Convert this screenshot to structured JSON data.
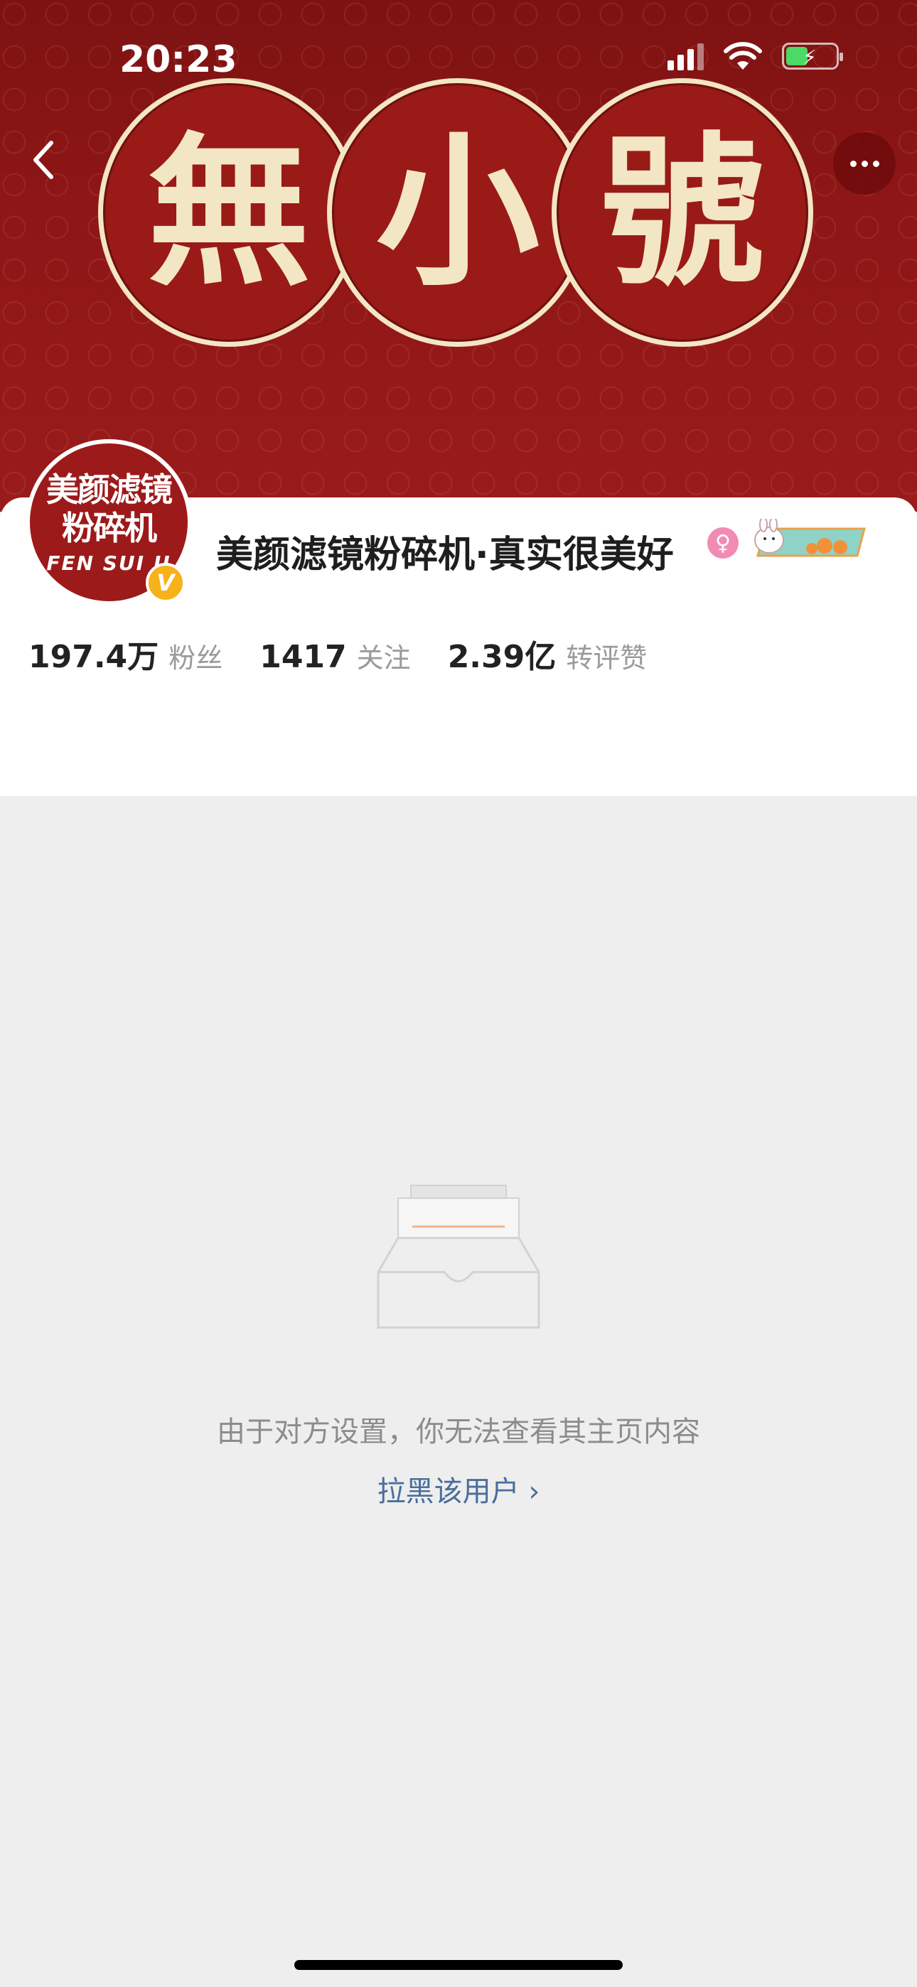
{
  "status_bar": {
    "time": "20:23"
  },
  "banner": {
    "chars": [
      "無",
      "小",
      "號"
    ]
  },
  "navigation": {
    "back_icon": "chevron-left-icon",
    "more_icon": "more-dots-icon"
  },
  "profile": {
    "avatar_lines": [
      "美颜滤镜",
      "粉碎机",
      "FEN SUI JI"
    ],
    "verified_badge": "V",
    "name": "美颜滤镜粉碎机·真实很美好",
    "gender_symbol": "♀"
  },
  "stats": [
    {
      "value": "197.4万",
      "label": "粉丝"
    },
    {
      "value": "1417",
      "label": "关注"
    },
    {
      "value": "2.39亿",
      "label": "转评赞"
    }
  ],
  "empty_state": {
    "message": "由于对方设置，你无法查看其主页内容",
    "block_link": "拉黑该用户 ›"
  },
  "colors": {
    "banner": "#8e1616",
    "accent_link": "#4a6e9c",
    "battery": "#4cd964"
  }
}
